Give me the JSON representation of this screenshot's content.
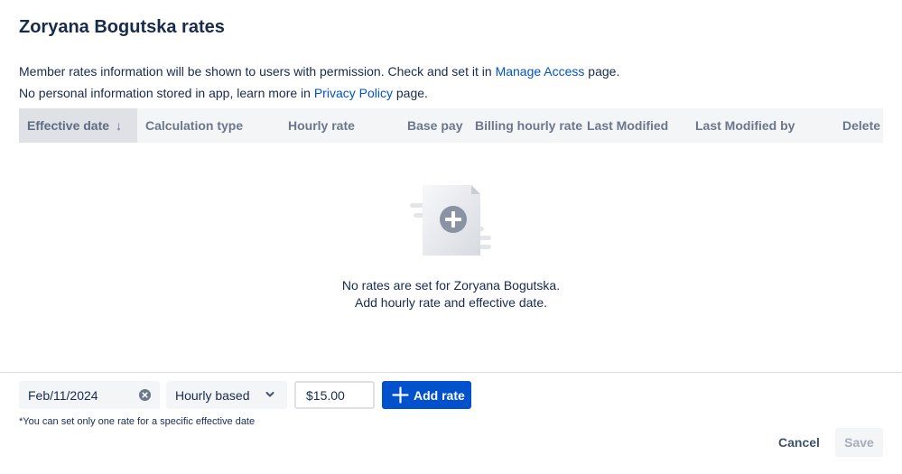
{
  "title": "Zoryana Bogutska rates",
  "info": {
    "line1_before": "Member rates information will be shown to users with permission. Check and set it in ",
    "line1_link": "Manage Access",
    "line1_after": " page.",
    "line2_before": "No personal information stored in app, learn more in ",
    "line2_link": "Privacy Policy",
    "line2_after": " page."
  },
  "table": {
    "columns": [
      {
        "label": "Effective date",
        "sort_glyph": "↓"
      },
      {
        "label": "Calculation type"
      },
      {
        "label": "Hourly rate"
      },
      {
        "label": "Base pay"
      },
      {
        "label": "Billing hourly rate"
      },
      {
        "label": "Last Modified"
      },
      {
        "label": "Last Modified by"
      },
      {
        "label": "Delete"
      }
    ]
  },
  "empty_state": {
    "icon": "add-document-icon",
    "line1": "No rates are set for Zoryana Bogutska.",
    "line2": "Add hourly rate and effective date."
  },
  "form": {
    "date_value": "Feb/11/2024",
    "calc_type_value": "Hourly based",
    "rate_value": "$15.00",
    "add_label": "Add rate",
    "note": "*You can set only one rate for a specific effective date"
  },
  "footer": {
    "cancel_label": "Cancel",
    "save_label": "Save"
  },
  "colors": {
    "primary": "#0052cc",
    "text": "#172b4d",
    "header_bg": "#f4f5f7",
    "sorted_header_bg": "#dfe1e6"
  }
}
